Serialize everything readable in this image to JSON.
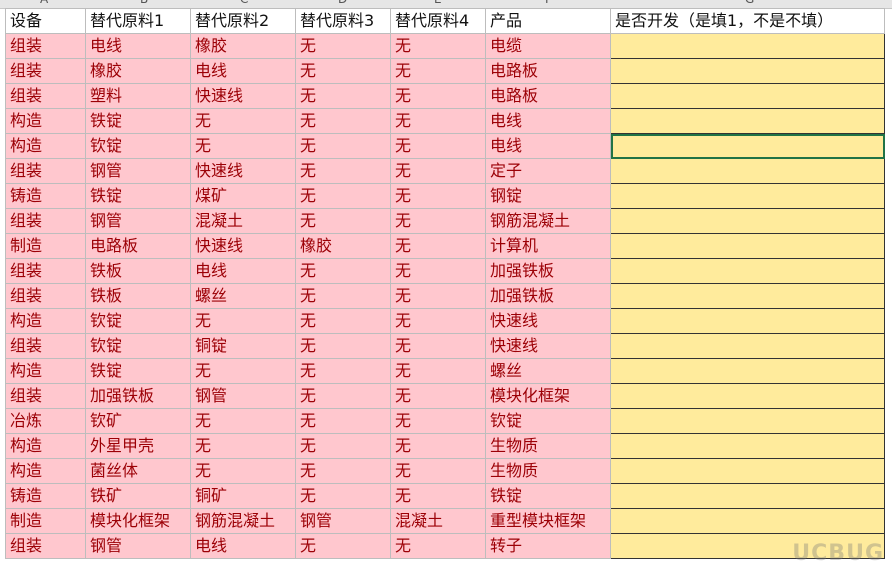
{
  "column_letters": [
    "A",
    "B",
    "C",
    "D",
    "E",
    "F",
    "G"
  ],
  "headers": [
    "设备",
    "替代原料1",
    "替代原料2",
    "替代原料3",
    "替代原料4",
    "产品",
    "是否开发（是填1，不是不填）"
  ],
  "rows": [
    [
      "组装",
      "电线",
      "橡胶",
      "无",
      "无",
      "电缆",
      ""
    ],
    [
      "组装",
      "橡胶",
      "电线",
      "无",
      "无",
      "电路板",
      ""
    ],
    [
      "组装",
      "塑料",
      "快速线",
      "无",
      "无",
      "电路板",
      ""
    ],
    [
      "构造",
      "铁锭",
      "无",
      "无",
      "无",
      "电线",
      ""
    ],
    [
      "构造",
      "钦锭",
      "无",
      "无",
      "无",
      "电线",
      ""
    ],
    [
      "组装",
      "钢管",
      "快速线",
      "无",
      "无",
      "定子",
      ""
    ],
    [
      "铸造",
      "铁锭",
      "煤矿",
      "无",
      "无",
      "钢锭",
      ""
    ],
    [
      "组装",
      "钢管",
      "混凝土",
      "无",
      "无",
      "钢筋混凝土",
      ""
    ],
    [
      "制造",
      "电路板",
      "快速线",
      "橡胶",
      "无",
      "计算机",
      ""
    ],
    [
      "组装",
      "铁板",
      "电线",
      "无",
      "无",
      "加强铁板",
      ""
    ],
    [
      "组装",
      "铁板",
      "螺丝",
      "无",
      "无",
      "加强铁板",
      ""
    ],
    [
      "构造",
      "钦锭",
      "无",
      "无",
      "无",
      "快速线",
      ""
    ],
    [
      "组装",
      "钦锭",
      "铜锭",
      "无",
      "无",
      "快速线",
      ""
    ],
    [
      "构造",
      "铁锭",
      "无",
      "无",
      "无",
      "螺丝",
      ""
    ],
    [
      "组装",
      "加强铁板",
      "钢管",
      "无",
      "无",
      "模块化框架",
      ""
    ],
    [
      "冶炼",
      "钦矿",
      "无",
      "无",
      "无",
      "钦锭",
      ""
    ],
    [
      "构造",
      "外星甲壳",
      "无",
      "无",
      "无",
      "生物质",
      ""
    ],
    [
      "构造",
      "菌丝体",
      "无",
      "无",
      "无",
      "生物质",
      ""
    ],
    [
      "铸造",
      "铁矿",
      "铜矿",
      "无",
      "无",
      "铁锭",
      ""
    ],
    [
      "制造",
      "模块化框架",
      "钢筋混凝土",
      "钢管",
      "混凝土",
      "重型模块框架",
      ""
    ],
    [
      "组装",
      "钢管",
      "电线",
      "无",
      "无",
      "转子",
      ""
    ]
  ],
  "selected_row_index": 4,
  "watermark": "UCBUG",
  "colors": {
    "data_fill": "#ffc7ce",
    "data_text": "#9c0006",
    "flag_fill": "#ffeb9c",
    "selection": "#217346"
  }
}
